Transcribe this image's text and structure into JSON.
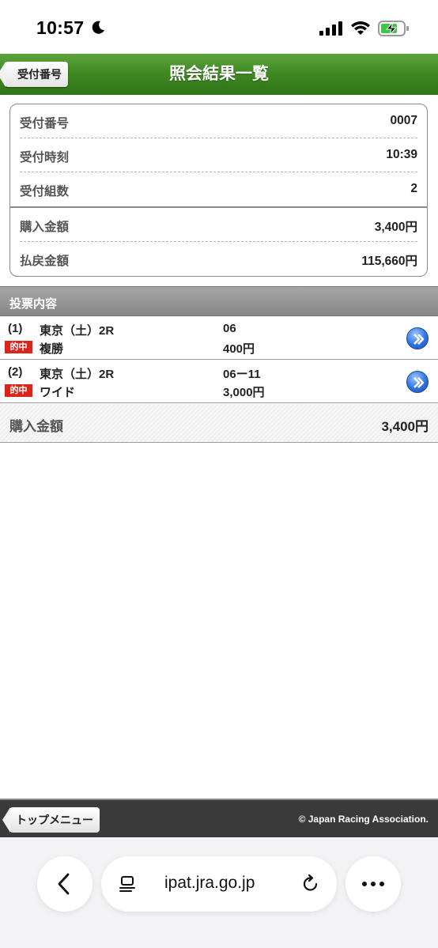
{
  "status_bar": {
    "time": "10:57",
    "icons": [
      "moon-icon",
      "signal-icon",
      "wifi-icon",
      "battery-charging-icon"
    ]
  },
  "header": {
    "back_label": "受付番号",
    "title": "照会結果一覧",
    "color": "#3f8a22"
  },
  "receipt": [
    {
      "label": "受付番号",
      "value": "0007"
    },
    {
      "label": "受付時刻",
      "value": "10:39"
    },
    {
      "label": "受付組数",
      "value": "2"
    },
    {
      "label": "購入金額",
      "value": "3,400円"
    },
    {
      "label": "払戻金額",
      "value": "115,660円"
    }
  ],
  "section_title": "投票内容",
  "bets": [
    {
      "num": "(1)",
      "race": "東京（土）2R",
      "combo": "06",
      "hit": "的中",
      "kind": "複勝",
      "amount": "400円"
    },
    {
      "num": "(2)",
      "race": "東京（土）2R",
      "combo": "06ー11",
      "hit": "的中",
      "kind": "ワイド",
      "amount": "3,000円"
    }
  ],
  "total": {
    "label": "購入金額",
    "value": "3,400円"
  },
  "footer": {
    "top_menu_label": "トップメニュー",
    "copyright": "© Japan Racing Association."
  },
  "browser": {
    "url": "ipat.jra.go.jp"
  },
  "colors": {
    "hit_badge": "#d9261c",
    "nav_arrow": "#2f74e0"
  }
}
